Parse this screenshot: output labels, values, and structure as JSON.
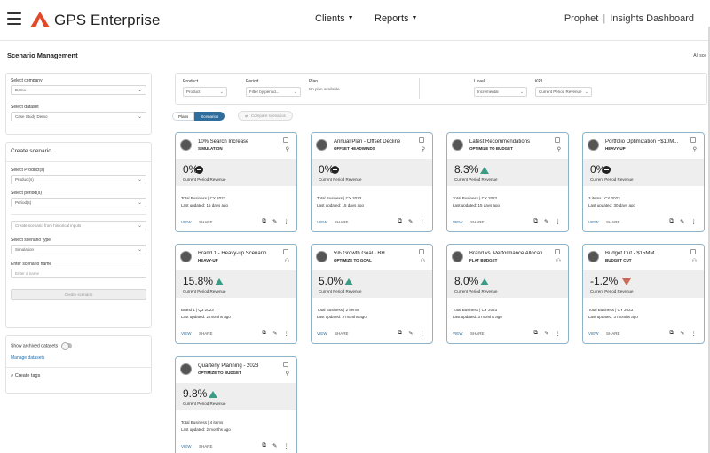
{
  "header": {
    "brand": "GPS Enterprise",
    "nav": [
      "Clients",
      "Reports"
    ],
    "prophet": "Prophet",
    "dashboard": "Insights Dashboard",
    "brand_color": "#e04a2a"
  },
  "page": {
    "title": "Scenario Management",
    "all_scenarios": "All sce"
  },
  "left": {
    "company_label": "Select company",
    "company_value": "Demo",
    "dataset_label": "Select dataset",
    "dataset_value": "Case Study Demo",
    "create_title": "Create scenario",
    "products_label": "Select Product(s)",
    "products_value": "Product(s)",
    "periods_label": "Select period(s)",
    "periods_value": "Period(s)",
    "historical_value": "Create scenario from historical inputs",
    "type_label": "Select scenario type",
    "type_value": "Simulation",
    "name_label": "Enter scenario name",
    "name_placeholder": "Enter a name",
    "create_button": "Create scenario",
    "archived_label": "Show archived datasets",
    "manage_link": "Manage datasets",
    "tags_label": "Create tags"
  },
  "filters": {
    "product_label": "Product",
    "product_value": "Product",
    "period_label": "Period",
    "period_value": "Filter by period...",
    "plan_label": "Plan",
    "plan_value": "No plan available",
    "level_label": "Level",
    "level_value": "Incremental",
    "kpi_label": "KPI",
    "kpi_value": "Current Period Revenue"
  },
  "tabs": {
    "plans": "Plans",
    "scenarios": "Scenarios",
    "compare": "Compare scenarios"
  },
  "cards": [
    {
      "title": "10% Search Increase",
      "type": "SIMULATION",
      "value": "0%",
      "trend": "neutral",
      "metric": "Current Period Revenue",
      "line1": "Total Business | CY 2023",
      "line2": "Last updated: 15 days ago",
      "owner_icon": "person-icon"
    },
    {
      "title": "Annual Plan - Offset Decline",
      "type": "OFFSET HEADWINDS",
      "value": "0%",
      "trend": "neutral",
      "metric": "Current Period Revenue",
      "line1": "Total Business | CY 2023",
      "line2": "Last updated: 15 days ago",
      "owner_icon": "person-icon"
    },
    {
      "title": "Latest Recommendations",
      "type": "OPTIMIZE TO BUDGET",
      "value": "8.3%",
      "trend": "up",
      "metric": "Current Period Revenue",
      "line1": "Total Business | CY 2022",
      "line2": "Last updated: 15 days ago",
      "owner_icon": "person-icon"
    },
    {
      "title": "Portfolio Optimization +$10M...",
      "type": "HEAVY-UP",
      "value": "0%",
      "trend": "neutral",
      "metric": "Current Period Revenue",
      "line1": "3 items | CY 2023",
      "line2": "Last updated: 30 days ago",
      "owner_icon": "person-icon"
    },
    {
      "title": "Brand 1 - Heavy-up Scenario",
      "type": "HEAVY-UP",
      "value": "15.8%",
      "trend": "up",
      "metric": "Current Period Revenue",
      "line1": "Brand 1 | Q3 2023",
      "line2": "Last updated: 2 months ago",
      "owner_icon": "team-icon"
    },
    {
      "title": "5% Growth Goal - BH",
      "type": "OPTIMIZE TO GOAL",
      "value": "5.0%",
      "trend": "up",
      "metric": "Current Period Revenue",
      "line1": "Total Business | 2 items",
      "line2": "Last updated: 3 months ago",
      "owner_icon": "team-icon"
    },
    {
      "title": "Brand vs. Performance Allocati...",
      "type": "FLAT BUDGET",
      "value": "8.0%",
      "trend": "up",
      "metric": "Current Period Revenue",
      "line1": "Total Business | CY 2023",
      "line2": "Last updated: 3 months ago",
      "owner_icon": "team-icon"
    },
    {
      "title": "Budget Cut - $15MM",
      "type": "BUDGET CUT",
      "value": "-1.2%",
      "trend": "down",
      "metric": "Current Period Revenue",
      "line1": "Total Business | CY 2023",
      "line2": "Last updated: 3 months ago",
      "owner_icon": "team-icon"
    },
    {
      "title": "Quarterly Planning - 2023",
      "type": "OPTIMIZE TO BUDGET",
      "value": "9.8%",
      "trend": "up",
      "metric": "Current Period Revenue",
      "line1": "Total Business | 4 items",
      "line2": "Last updated: 2 months ago",
      "owner_icon": "person-icon"
    }
  ],
  "card_actions": {
    "view": "VIEW",
    "share": "SHARE",
    "up_color": "#3a9c85",
    "down_color": "#c96a58"
  }
}
